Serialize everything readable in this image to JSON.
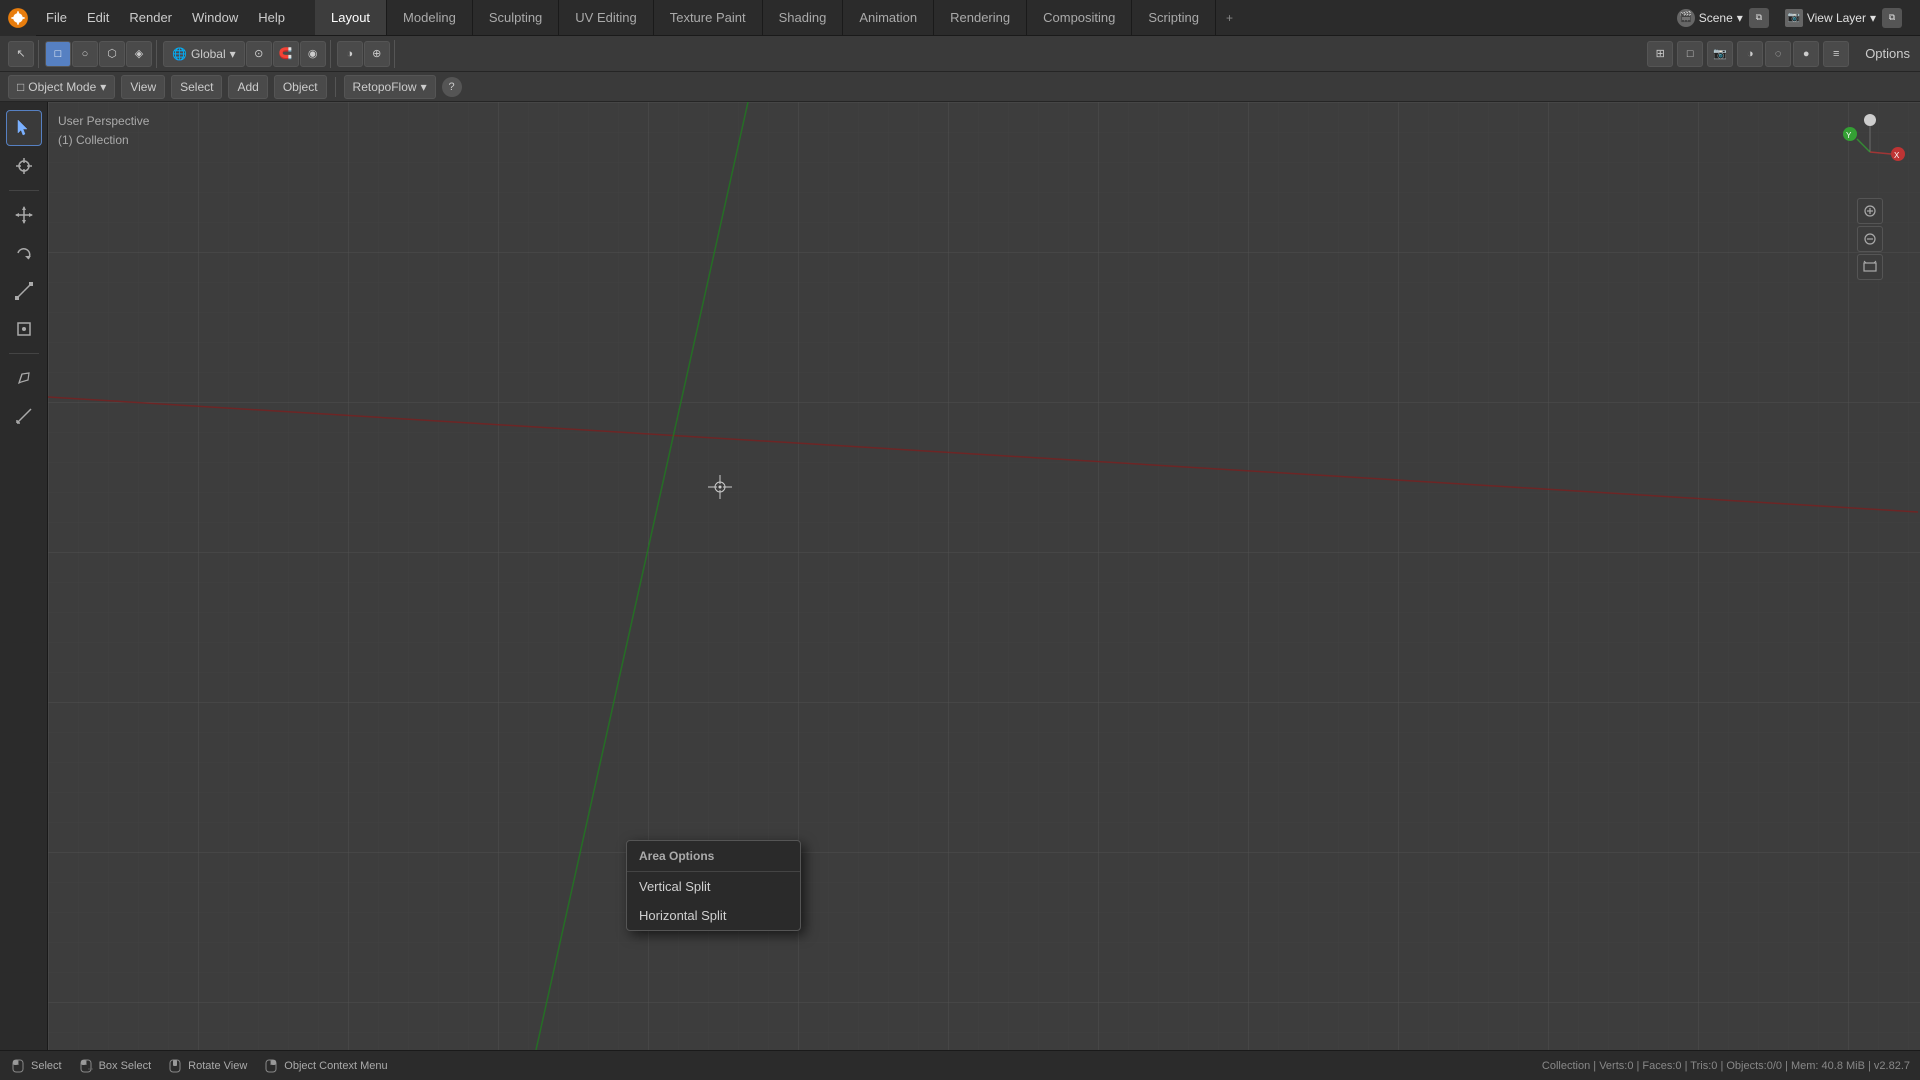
{
  "topMenu": {
    "items": [
      "File",
      "Edit",
      "Render",
      "Window",
      "Help"
    ],
    "workspaceTabs": [
      {
        "label": "Layout",
        "active": true
      },
      {
        "label": "Modeling",
        "active": false
      },
      {
        "label": "Sculpting",
        "active": false
      },
      {
        "label": "UV Editing",
        "active": false
      },
      {
        "label": "Texture Paint",
        "active": false
      },
      {
        "label": "Shading",
        "active": false
      },
      {
        "label": "Animation",
        "active": false
      },
      {
        "label": "Rendering",
        "active": false
      },
      {
        "label": "Compositing",
        "active": false
      },
      {
        "label": "Scripting",
        "active": false
      }
    ],
    "scene": {
      "label": "Scene",
      "icon": "🎬"
    },
    "viewLayer": {
      "label": "View Layer",
      "icon": "📷"
    }
  },
  "toolbar": {
    "options_label": "Options"
  },
  "modeBar": {
    "mode": "Object Mode",
    "view": "View",
    "select": "Select",
    "add": "Add",
    "object": "Object",
    "retopoflow": "RetopoFlow",
    "dropdown_arrow": "▾"
  },
  "viewport": {
    "perspectiveLabel": "User Perspective",
    "collectionLabel": "(1) Collection"
  },
  "leftToolbar": {
    "tools": [
      {
        "icon": "↖",
        "label": "select",
        "active": true
      },
      {
        "icon": "⊕",
        "label": "cursor",
        "active": false
      },
      {
        "icon": "↔",
        "label": "move",
        "active": false
      },
      {
        "icon": "↺",
        "label": "rotate",
        "active": false
      },
      {
        "icon": "⤡",
        "label": "scale",
        "active": false
      },
      {
        "icon": "⊞",
        "label": "transform",
        "active": false
      },
      {
        "divider": true
      },
      {
        "icon": "✏",
        "label": "annotate",
        "active": false
      },
      {
        "icon": "📐",
        "label": "measure",
        "active": false
      }
    ]
  },
  "contextMenu": {
    "title": "Area Options",
    "items": [
      {
        "label": "Vertical Split"
      },
      {
        "label": "Horizontal Split"
      }
    ]
  },
  "bottomBar": {
    "items": [
      {
        "icon": "◉",
        "label": "Select"
      },
      {
        "icon": "□",
        "label": "Box Select"
      },
      {
        "icon": "○",
        "label": "Rotate View"
      },
      {
        "icon": "□",
        "label": "Object Context Menu"
      }
    ],
    "statusRight": "Collection | Verts:0 | Faces:0 | Tris:0 | Objects:0/0 | Mem: 40.8 MiB | v2.82.7"
  }
}
